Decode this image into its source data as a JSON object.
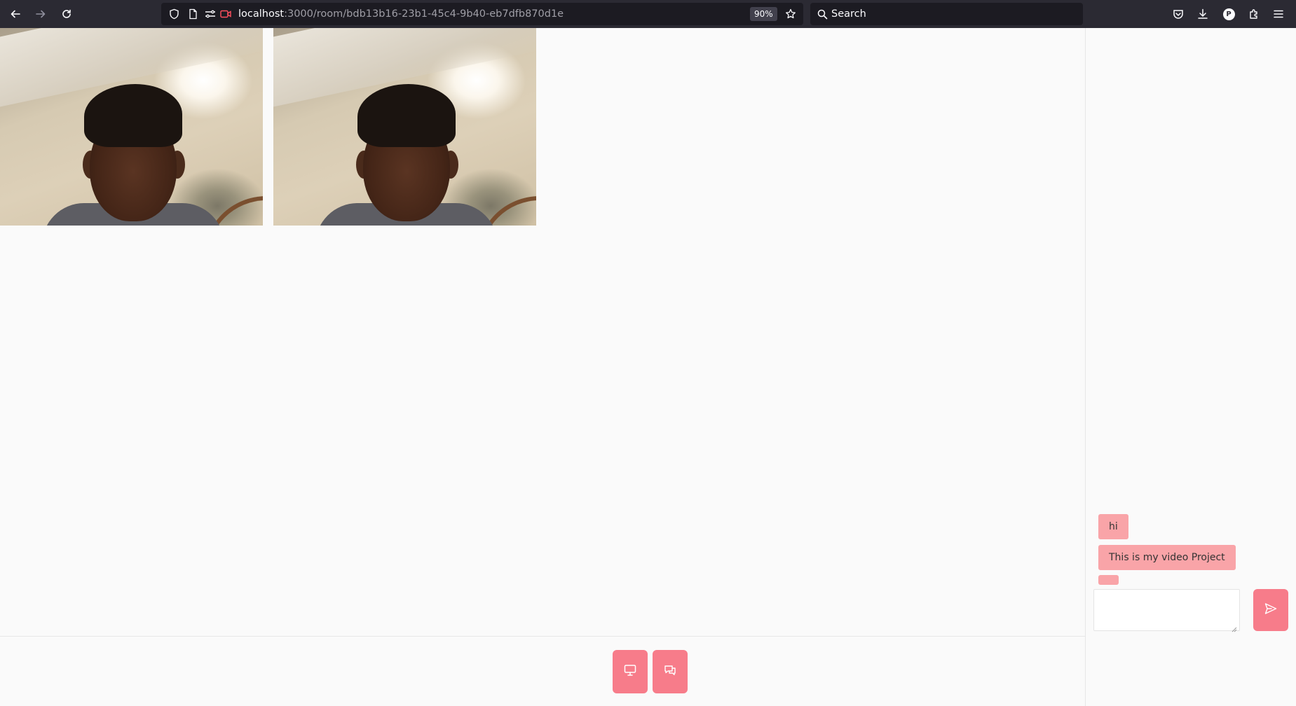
{
  "browser": {
    "url_host": "localhost",
    "url_rest": ":3000/room/bdb13b16-23b1-45c4-9b40-eb7dfb870d1e",
    "zoom": "90%",
    "search_placeholder": "Search",
    "profile_initial": "P"
  },
  "icons": {
    "back": "back-arrow-icon",
    "forward": "forward-arrow-icon",
    "reload": "reload-icon",
    "shield": "shield-icon",
    "page": "page-icon",
    "permissions": "permissions-icon",
    "camera": "camera-sharing-icon",
    "bookmark": "star-icon",
    "search": "search-icon",
    "pocket": "pocket-icon",
    "downloads": "download-icon",
    "extensions": "puzzle-icon",
    "menu": "hamburger-menu-icon",
    "screen_share": "monitor-icon",
    "chat": "chat-bubbles-icon",
    "send": "send-icon"
  },
  "chat": {
    "messages": [
      {
        "text": "hi"
      },
      {
        "text": "This is my video Project"
      },
      {
        "text": ""
      }
    ],
    "input_value": ""
  },
  "colors": {
    "accent": "#f77c8a",
    "bubble": "#f9a4a8",
    "toolbar": "#2b2a33",
    "urlbar": "#1c1b22"
  }
}
